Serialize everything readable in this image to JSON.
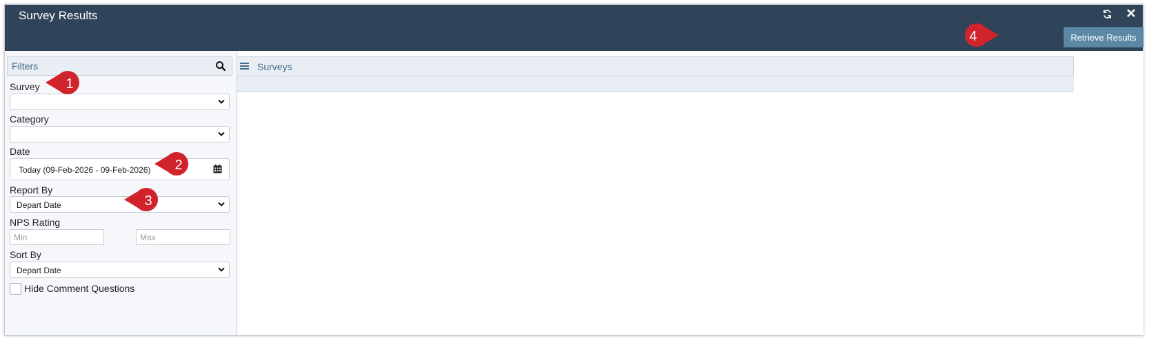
{
  "window": {
    "title": "Survey Results"
  },
  "toolbar": {
    "retrieve_label": "Retrieve Results"
  },
  "filters": {
    "header": "Filters",
    "survey": {
      "label": "Survey",
      "value": ""
    },
    "category": {
      "label": "Category",
      "value": ""
    },
    "date": {
      "label": "Date",
      "value": "Today (09-Feb-2026 - 09-Feb-2026)"
    },
    "report_by": {
      "label": "Report By",
      "value": "Depart Date"
    },
    "nps": {
      "label": "NPS Rating",
      "min_placeholder": "Min",
      "max_placeholder": "Max"
    },
    "sort_by": {
      "label": "Sort By",
      "value": "Depart Date"
    },
    "hide_comments": {
      "label": "Hide Comment Questions",
      "checked": false
    }
  },
  "surveys": {
    "header": "Surveys"
  },
  "callouts": [
    "1",
    "2",
    "3",
    "4"
  ],
  "colors": {
    "titlebar": "#2f4459",
    "button": "#5b88a5",
    "callout": "#d1232c",
    "accent_text": "#3f6a8a"
  }
}
